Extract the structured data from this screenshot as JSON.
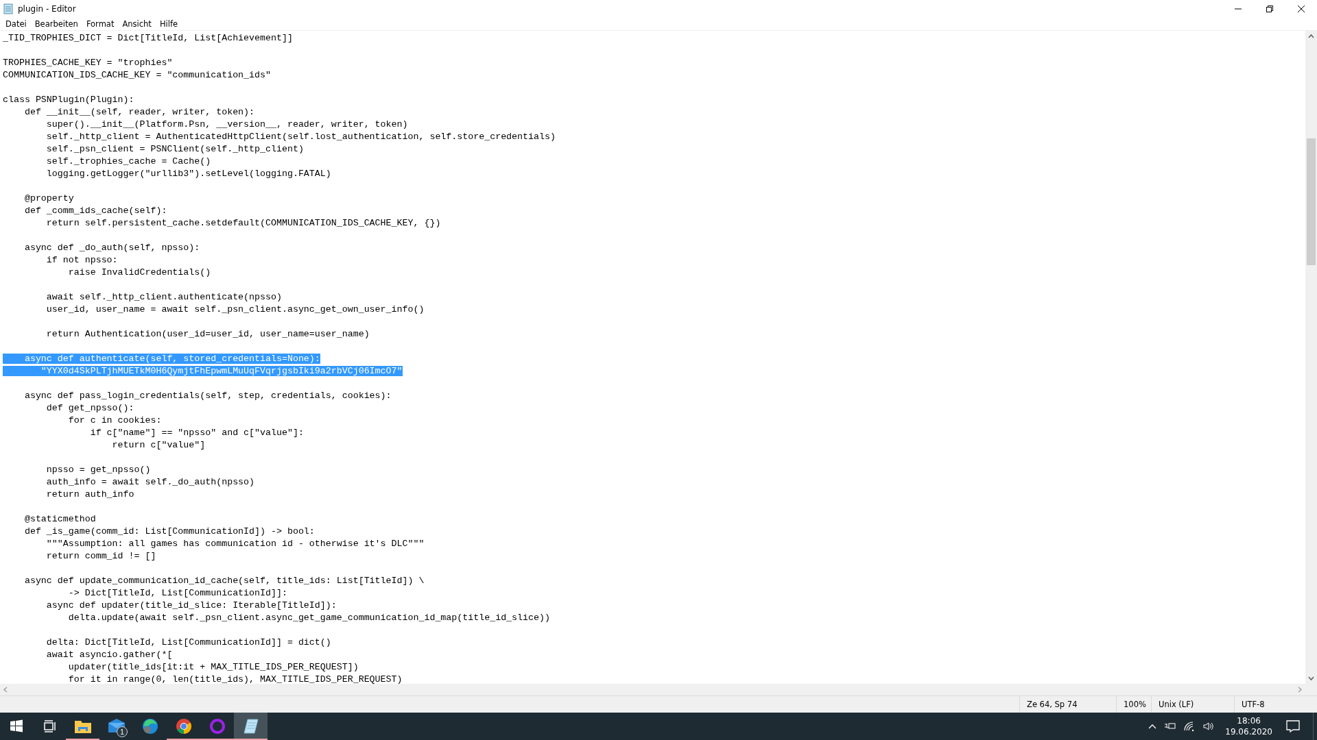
{
  "window": {
    "title": "plugin - Editor"
  },
  "menu": [
    "Datei",
    "Bearbeiten",
    "Format",
    "Ansicht",
    "Hilfe"
  ],
  "editor": {
    "lines": [
      {
        "kind": "code",
        "text": "_TID_TROPHIES_DICT = Dict[TitleId, List[Achievement]]",
        "selected": false
      },
      {
        "kind": "blank"
      },
      {
        "kind": "code",
        "text": "TROPHIES_CACHE_KEY = \"trophies\"",
        "selected": false
      },
      {
        "kind": "code",
        "text": "COMMUNICATION_IDS_CACHE_KEY = \"communication_ids\"",
        "selected": false
      },
      {
        "kind": "blank"
      },
      {
        "kind": "code",
        "text": "class PSNPlugin(Plugin):",
        "selected": false
      },
      {
        "kind": "code",
        "text": "    def __init__(self, reader, writer, token):",
        "selected": false
      },
      {
        "kind": "code",
        "text": "        super().__init__(Platform.Psn, __version__, reader, writer, token)",
        "selected": false
      },
      {
        "kind": "code",
        "text": "        self._http_client = AuthenticatedHttpClient(self.lost_authentication, self.store_credentials)",
        "selected": false
      },
      {
        "kind": "code",
        "text": "        self._psn_client = PSNClient(self._http_client)",
        "selected": false
      },
      {
        "kind": "code",
        "text": "        self._trophies_cache = Cache()",
        "selected": false
      },
      {
        "kind": "code",
        "text": "        logging.getLogger(\"urllib3\").setLevel(logging.FATAL)",
        "selected": false
      },
      {
        "kind": "blank"
      },
      {
        "kind": "code",
        "text": "    @property",
        "selected": false
      },
      {
        "kind": "code",
        "text": "    def _comm_ids_cache(self):",
        "selected": false
      },
      {
        "kind": "code",
        "text": "        return self.persistent_cache.setdefault(COMMUNICATION_IDS_CACHE_KEY, {})",
        "selected": false
      },
      {
        "kind": "blank"
      },
      {
        "kind": "code",
        "text": "    async def _do_auth(self, npsso):",
        "selected": false
      },
      {
        "kind": "code",
        "text": "        if not npsso:",
        "selected": false
      },
      {
        "kind": "code",
        "text": "            raise InvalidCredentials()",
        "selected": false
      },
      {
        "kind": "blank"
      },
      {
        "kind": "code",
        "text": "        await self._http_client.authenticate(npsso)",
        "selected": false
      },
      {
        "kind": "code",
        "text": "        user_id, user_name = await self._psn_client.async_get_own_user_info()",
        "selected": false
      },
      {
        "kind": "blank"
      },
      {
        "kind": "code",
        "text": "        return Authentication(user_id=user_id, user_name=user_name)",
        "selected": false
      },
      {
        "kind": "blank"
      },
      {
        "kind": "code",
        "text": "    async def authenticate(self, stored_credentials=None):",
        "selected": true
      },
      {
        "kind": "code",
        "text": "       \"YYX0d4SkPLTjhMUETkM0H6QymjtFhEpwmLMuUqFVqrjgsbIki9a2rbVCj06ImcO7\"",
        "selected": true
      },
      {
        "kind": "blank"
      },
      {
        "kind": "code",
        "text": "    async def pass_login_credentials(self, step, credentials, cookies):",
        "selected": false
      },
      {
        "kind": "code",
        "text": "        def get_npsso():",
        "selected": false
      },
      {
        "kind": "code",
        "text": "            for c in cookies:",
        "selected": false
      },
      {
        "kind": "code",
        "text": "                if c[\"name\"] == \"npsso\" and c[\"value\"]:",
        "selected": false
      },
      {
        "kind": "code",
        "text": "                    return c[\"value\"]",
        "selected": false
      },
      {
        "kind": "blank"
      },
      {
        "kind": "code",
        "text": "        npsso = get_npsso()",
        "selected": false
      },
      {
        "kind": "code",
        "text": "        auth_info = await self._do_auth(npsso)",
        "selected": false
      },
      {
        "kind": "code",
        "text": "        return auth_info",
        "selected": false
      },
      {
        "kind": "blank"
      },
      {
        "kind": "code",
        "text": "    @staticmethod",
        "selected": false
      },
      {
        "kind": "code",
        "text": "    def _is_game(comm_id: List[CommunicationId]) -> bool:",
        "selected": false
      },
      {
        "kind": "code",
        "text": "        \"\"\"Assumption: all games has communication id - otherwise it's DLC\"\"\"",
        "selected": false
      },
      {
        "kind": "code",
        "text": "        return comm_id != []",
        "selected": false
      },
      {
        "kind": "blank"
      },
      {
        "kind": "code",
        "text": "    async def update_communication_id_cache(self, title_ids: List[TitleId]) \\",
        "selected": false
      },
      {
        "kind": "code",
        "text": "            -> Dict[TitleId, List[CommunicationId]]:",
        "selected": false
      },
      {
        "kind": "code",
        "text": "        async def updater(title_id_slice: Iterable[TitleId]):",
        "selected": false
      },
      {
        "kind": "code",
        "text": "            delta.update(await self._psn_client.async_get_game_communication_id_map(title_id_slice))",
        "selected": false
      },
      {
        "kind": "blank"
      },
      {
        "kind": "code",
        "text": "        delta: Dict[TitleId, List[CommunicationId]] = dict()",
        "selected": false
      },
      {
        "kind": "code",
        "text": "        await asyncio.gather(*[",
        "selected": false
      },
      {
        "kind": "code",
        "text": "            updater(title_ids[it:it + MAX_TITLE_IDS_PER_REQUEST])",
        "selected": false
      },
      {
        "kind": "code",
        "text": "            for it in range(0, len(title_ids), MAX_TITLE_IDS_PER_REQUEST)",
        "selected": false
      }
    ]
  },
  "status_bar": {
    "position": "Ze 64, Sp 74",
    "zoom": "100%",
    "line_ending": "Unix (LF)",
    "encoding": "UTF-8"
  },
  "taskbar": {
    "apps": [
      {
        "kind": "explorer",
        "open": true,
        "selected": false
      },
      {
        "kind": "mail",
        "open": false,
        "selected": false,
        "badge": "1"
      },
      {
        "kind": "edge",
        "open": false,
        "selected": false
      },
      {
        "kind": "chrome",
        "open": true,
        "selected": false
      },
      {
        "kind": "ring",
        "open": true,
        "selected": false
      },
      {
        "kind": "notepad",
        "open": true,
        "selected": true
      }
    ],
    "time": "18:06",
    "date": "19.06.2020"
  }
}
